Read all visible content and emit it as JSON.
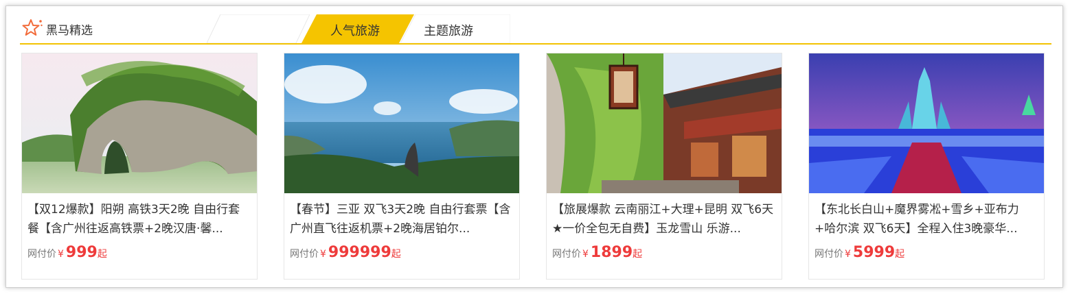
{
  "header": {
    "brand_label": "黑马精选",
    "tabs": [
      {
        "label": "",
        "active": false
      },
      {
        "label": "人气旅游",
        "active": true
      },
      {
        "label": "主题旅游",
        "active": false
      }
    ]
  },
  "colors": {
    "accent": "#f5c400",
    "price": "#ee3b3b",
    "brand_star": "#f26b3a"
  },
  "cards": [
    {
      "image": "karst-rock-arch-river",
      "title": "【双12爆款】阳朔 高铁3天2晚 自由行套餐【含广州往返高铁票+2晚汉唐·馨...",
      "price_label": "网付价",
      "currency": "¥",
      "price": "999",
      "suffix": "起"
    },
    {
      "image": "coastal-bay-mountain-view",
      "title": "【春节】三亚 双飞3天2晚 自由行套票【含广州直飞往返机票+2晚海居铂尔...",
      "price_label": "网付价",
      "currency": "¥",
      "price": "999999",
      "suffix": "起"
    },
    {
      "image": "ancient-town-lantern-street",
      "title": "【旅展爆款 云南丽江+大理+昆明 双飞6天★一价全包无自费】玉龙雪山 乐游...",
      "price_label": "网付价",
      "currency": "¥",
      "price": "1899",
      "suffix": "起"
    },
    {
      "image": "ice-sculpture-castle-night",
      "title": "【东北长白山+魔界雾凇+雪乡+亚布力+哈尔滨 双飞6天】全程入住3晚豪华...",
      "price_label": "网付价",
      "currency": "¥",
      "price": "5999",
      "suffix": "起"
    }
  ]
}
